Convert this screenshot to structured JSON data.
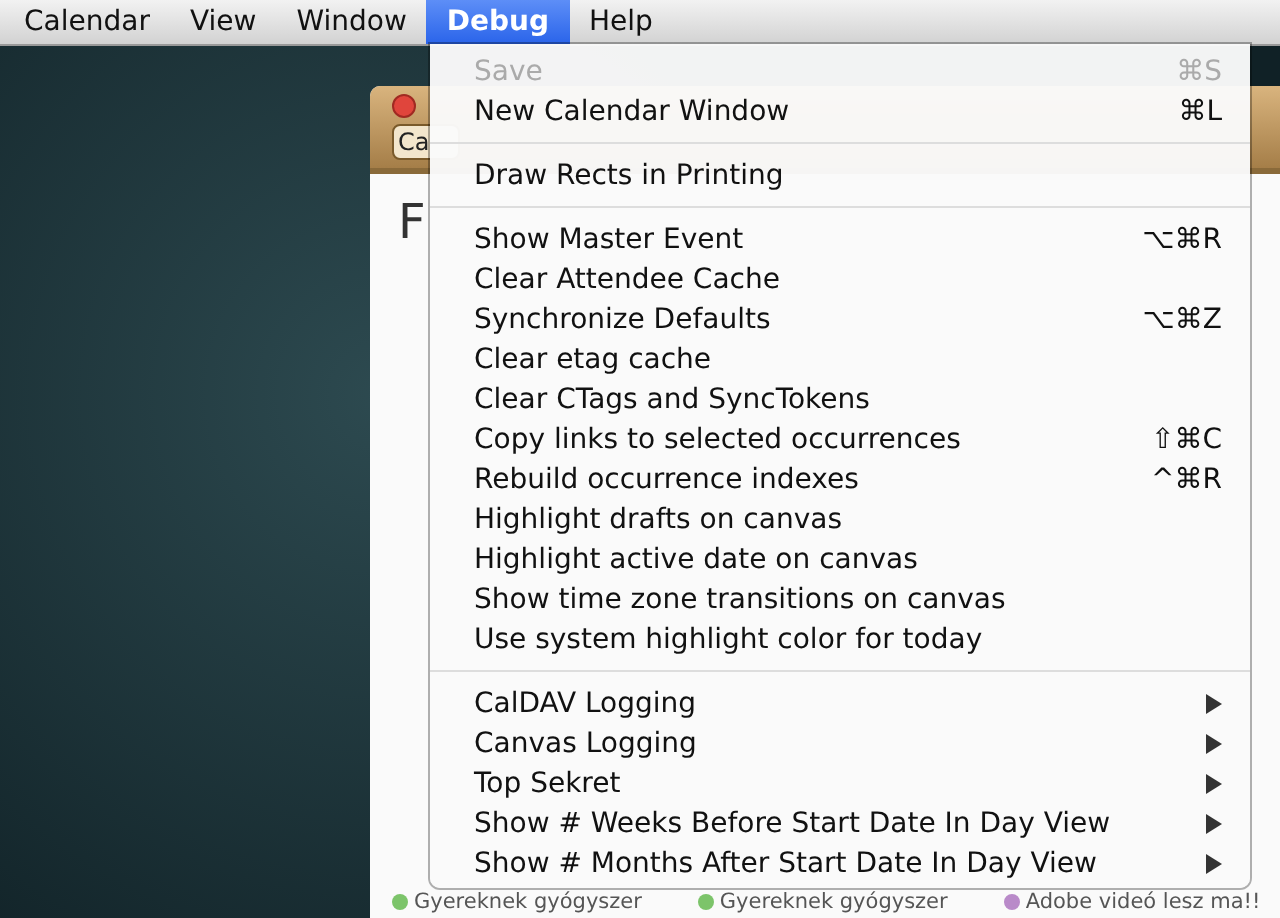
{
  "menu_bar": [
    {
      "label": "Calendar",
      "selected": false
    },
    {
      "label": "View",
      "selected": false
    },
    {
      "label": "Window",
      "selected": false
    },
    {
      "label": "Debug",
      "selected": true
    },
    {
      "label": "Help",
      "selected": false
    }
  ],
  "calendar_window": {
    "toolbar_button": "Ca",
    "heading": "F",
    "events": [
      {
        "title": "Gyereknek gyógyszer",
        "color": "#7cc46a"
      },
      {
        "title": "Gyereknek gyógyszer",
        "color": "#7cc46a"
      },
      {
        "title": "Adobe videó lesz ma!!",
        "color": "#b98ac9"
      }
    ]
  },
  "menu": [
    {
      "kind": "item",
      "label": "Save",
      "shortcut": "⌘S",
      "disabled": true
    },
    {
      "kind": "item",
      "label": "New Calendar Window",
      "shortcut": "⌘L",
      "disabled": false
    },
    {
      "kind": "separator"
    },
    {
      "kind": "item",
      "label": "Draw Rects in Printing",
      "disabled": false
    },
    {
      "kind": "separator"
    },
    {
      "kind": "item",
      "label": "Show Master Event",
      "shortcut": "⌥⌘R",
      "disabled": false
    },
    {
      "kind": "item",
      "label": "Clear Attendee Cache",
      "disabled": false
    },
    {
      "kind": "item",
      "label": "Synchronize Defaults",
      "shortcut": "⌥⌘Z",
      "disabled": false
    },
    {
      "kind": "item",
      "label": "Clear etag cache",
      "disabled": false
    },
    {
      "kind": "item",
      "label": "Clear CTags and SyncTokens",
      "disabled": false
    },
    {
      "kind": "item",
      "label": "Copy links to selected occurrences",
      "shortcut": "⇧⌘C",
      "disabled": false
    },
    {
      "kind": "item",
      "label": "Rebuild occurrence indexes",
      "shortcut": "^⌘R",
      "disabled": false
    },
    {
      "kind": "item",
      "label": "Highlight drafts on canvas",
      "disabled": false
    },
    {
      "kind": "item",
      "label": "Highlight active date on canvas",
      "disabled": false
    },
    {
      "kind": "item",
      "label": "Show time zone transitions on canvas",
      "disabled": false
    },
    {
      "kind": "item",
      "label": "Use system highlight color for today",
      "disabled": false
    },
    {
      "kind": "separator"
    },
    {
      "kind": "submenu",
      "label": "CalDAV Logging",
      "disabled": false
    },
    {
      "kind": "submenu",
      "label": "Canvas Logging",
      "disabled": false
    },
    {
      "kind": "submenu",
      "label": "Top Sekret",
      "disabled": false
    },
    {
      "kind": "submenu",
      "label": "Show # Weeks Before Start Date In Day View",
      "disabled": false
    },
    {
      "kind": "submenu",
      "label": "Show # Months After Start Date In Day View",
      "disabled": false
    }
  ]
}
